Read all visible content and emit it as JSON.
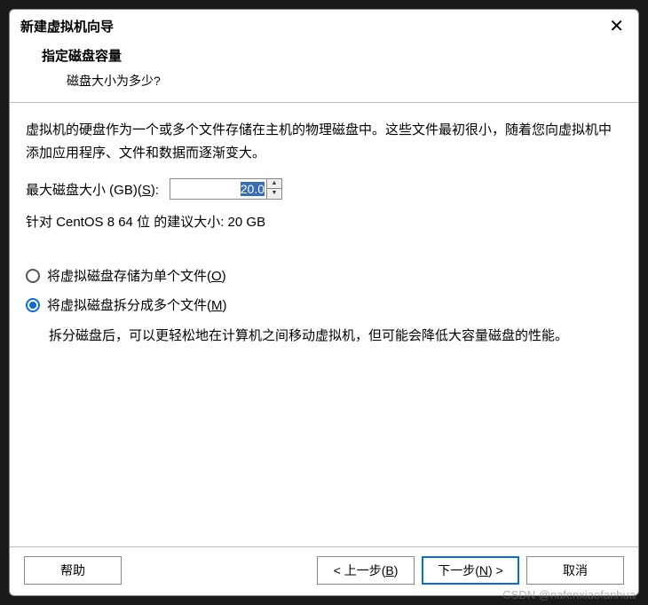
{
  "window": {
    "title": "新建虚拟机向导"
  },
  "header": {
    "title": "指定磁盘容量",
    "subtitle": "磁盘大小为多少?"
  },
  "content": {
    "description": "虚拟机的硬盘作为一个或多个文件存储在主机的物理磁盘中。这些文件最初很小，随着您向虚拟机中添加应用程序、文件和数据而逐渐变大。",
    "max_size_label_pre": "最大磁盘大小 (GB)(",
    "max_size_label_u": "S",
    "max_size_label_post": "):",
    "max_size_value": "20.0",
    "suggestion": "针对 CentOS 8 64 位 的建议大小: 20 GB",
    "radios": {
      "single": {
        "pre": "将虚拟磁盘存储为单个文件(",
        "u": "O",
        "post": ")"
      },
      "split": {
        "pre": "将虚拟磁盘拆分成多个文件(",
        "u": "M",
        "post": ")"
      }
    },
    "split_desc": "拆分磁盘后，可以更轻松地在计算机之间移动虚拟机，但可能会降低大容量磁盘的性能。"
  },
  "footer": {
    "help": "帮助",
    "back_pre": "< 上一步(",
    "back_u": "B",
    "back_post": ")",
    "next_pre": "下一步(",
    "next_u": "N",
    "next_post": ") >",
    "cancel": "取消"
  },
  "watermark": "CSDN @nafenxiaofanhua"
}
